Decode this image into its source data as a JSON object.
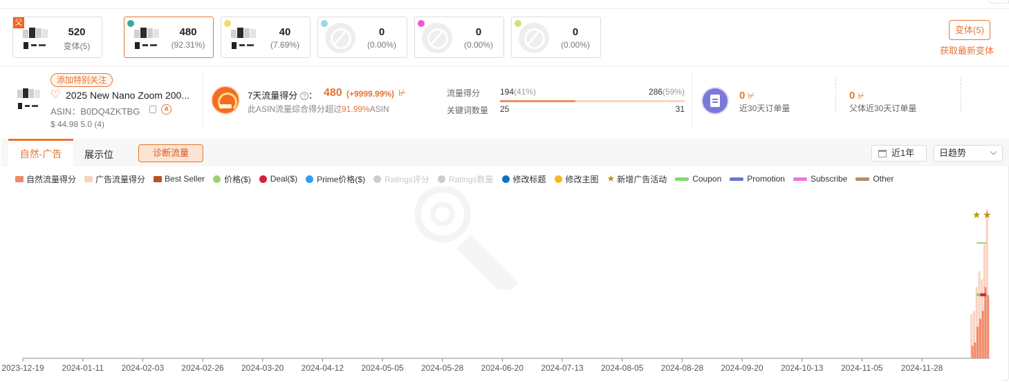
{
  "variants": [
    {
      "num": "520",
      "sub": "变体(5)",
      "parent_label": "父",
      "kind": "parent"
    },
    {
      "num": "480",
      "sub": "(92.31%)",
      "dot": "#3aa99f",
      "kind": "product",
      "active": true
    },
    {
      "num": "40",
      "sub": "(7.69%)",
      "dot": "#f2dc6a",
      "kind": "product"
    },
    {
      "num": "0",
      "sub": "(0.00%)",
      "dot": "#9ed6ea",
      "kind": "placeholder"
    },
    {
      "num": "0",
      "sub": "(0.00%)",
      "dot": "#ee55dd",
      "kind": "placeholder"
    },
    {
      "num": "0",
      "sub": "(0.00%)",
      "dot": "#cfe07a",
      "kind": "placeholder"
    }
  ],
  "variant_button": "变体(5)",
  "get_latest_variants": "获取最新变体",
  "product": {
    "follow_tag": "添加特别关注",
    "title": "2025 New Nano Zoom 200...",
    "asin": "ASIN：B0DQ4ZKTBG",
    "amazon_icon_text": "a",
    "price_rating": "$ 44.98 5.0 (4)"
  },
  "traffic_score": {
    "label": "7天流量得分",
    "help": "?",
    "colon": "：",
    "value": "480",
    "change": "(+9999.99%)",
    "trend_icon": "⊬",
    "desc_prefix": "此ASIN流量综合得分超过",
    "desc_pct": "91.99%",
    "desc_suffix": "ASIN"
  },
  "flow": {
    "score_label": "流量得分",
    "kw_label": "关键词数量",
    "natural_score": "194",
    "natural_pct": "(41%)",
    "ad_score": "286",
    "ad_pct": "(59%)",
    "natural_share": 0.41,
    "kw_natural": "25",
    "kw_ad": "31"
  },
  "orders": {
    "child_num": "0",
    "child_label": "近30天订单量",
    "parent_num": "0",
    "parent_label": "父体近30天订单量",
    "trend_icon": "⊬"
  },
  "tabs": {
    "natural_ad": "自然-广告",
    "display": "展示位",
    "diagnose": "诊断流量"
  },
  "range": {
    "label": "近1年"
  },
  "trend_select": {
    "value": "日趋势"
  },
  "legend": [
    {
      "name": "自然流量得分",
      "color": "#f0896a",
      "shape": "rect"
    },
    {
      "name": "广告流量得分",
      "color": "#fcd0bd",
      "shape": "rect"
    },
    {
      "name": "Best Seller",
      "color": "#b8541e",
      "shape": "rect"
    },
    {
      "name": "价格($)",
      "color": "#9fd170",
      "shape": "dot"
    },
    {
      "name": "Deal($)",
      "color": "#d61f3c",
      "shape": "dot"
    },
    {
      "name": "Prime价格($)",
      "color": "#2e9df2",
      "shape": "dot"
    },
    {
      "name": "Ratings评分",
      "color": "#cccccc",
      "shape": "dot",
      "disabled": true
    },
    {
      "name": "Ratings数量",
      "color": "#cccccc",
      "shape": "dot",
      "disabled": true
    },
    {
      "name": "修改标题",
      "color": "#1171c4",
      "shape": "dot"
    },
    {
      "name": "修改主图",
      "color": "#f5b825",
      "shape": "dot"
    },
    {
      "name": "新增广告活动",
      "color": "#b59612",
      "shape": "star"
    },
    {
      "name": "Coupon",
      "color": "#80d86c",
      "shape": "line"
    },
    {
      "name": "Promotion",
      "color": "#6b73cf",
      "shape": "line"
    },
    {
      "name": "Subscribe",
      "color": "#ef74e0",
      "shape": "line"
    },
    {
      "name": "Other",
      "color": "#b88b64",
      "shape": "line"
    }
  ],
  "chart_data": {
    "type": "bar",
    "x_tick_labels": [
      "2023-12-19",
      "2024-01-11",
      "2024-02-03",
      "2024-02-26",
      "2024-03-20",
      "2024-04-12",
      "2024-05-05",
      "2024-05-28",
      "2024-06-20",
      "2024-07-13",
      "2024-08-05",
      "2024-08-28",
      "2024-09-20",
      "2024-10-13",
      "2024-11-05",
      "2024-11-28"
    ],
    "x_start": "2023-12-19",
    "x_end": "2024-12-24",
    "y_axis_visible": false,
    "grid": false,
    "legend_position": "top-left",
    "series": [
      {
        "name": "自然流量得分",
        "dates": [
          "2024-12-17",
          "2024-12-18",
          "2024-12-19",
          "2024-12-20",
          "2024-12-21",
          "2024-12-22",
          "2024-12-23"
        ],
        "values": [
          8,
          10,
          20,
          25,
          30,
          45,
          40
        ]
      },
      {
        "name": "广告流量得分",
        "dates": [
          "2024-12-17",
          "2024-12-18",
          "2024-12-19",
          "2024-12-20",
          "2024-12-21",
          "2024-12-22",
          "2024-12-23"
        ],
        "values": [
          28,
          30,
          45,
          55,
          50,
          72,
          94
        ]
      }
    ],
    "events": [
      {
        "name": "新增广告活动",
        "dates": [
          "2024-12-19",
          "2024-12-23"
        ]
      },
      {
        "name": "价格($)",
        "from": "2024-12-19",
        "to": "2024-12-23"
      },
      {
        "name": "Coupon",
        "from": "2024-12-19",
        "to": "2024-12-23"
      },
      {
        "name": "Deal($)",
        "dates": [
          "2024-12-21",
          "2024-12-22"
        ]
      }
    ]
  }
}
